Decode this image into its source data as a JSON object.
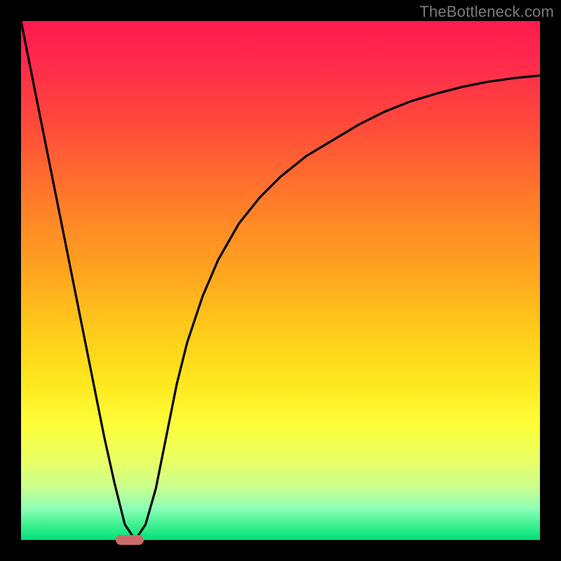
{
  "attribution": "TheBottleneck.com",
  "colors": {
    "frame": "#000000",
    "gradient_top": "#ff1a4d",
    "gradient_bottom": "#00e07a",
    "curve_stroke": "#000000",
    "marker": "#cc6a6a",
    "attribution_text": "#7b7b7b"
  },
  "chart_data": {
    "type": "line",
    "title": "",
    "xlabel": "",
    "ylabel": "",
    "xlim": [
      0,
      100
    ],
    "ylim": [
      0,
      100
    ],
    "x": [
      0,
      2,
      4,
      6,
      8,
      10,
      12,
      14,
      16,
      18,
      20,
      22,
      24,
      26,
      28,
      30,
      32,
      35,
      38,
      42,
      46,
      50,
      55,
      60,
      65,
      70,
      75,
      80,
      85,
      90,
      95,
      100
    ],
    "values": [
      100,
      90,
      80,
      70,
      60,
      50,
      40,
      30,
      20,
      11,
      3,
      0,
      3,
      10,
      20,
      30,
      38,
      47,
      54,
      61,
      66,
      70,
      74,
      77,
      80,
      82.5,
      84.5,
      86,
      87.3,
      88.3,
      89,
      89.5
    ],
    "marker_x": 21,
    "marker_y": 0,
    "grid": false,
    "legend": false
  }
}
